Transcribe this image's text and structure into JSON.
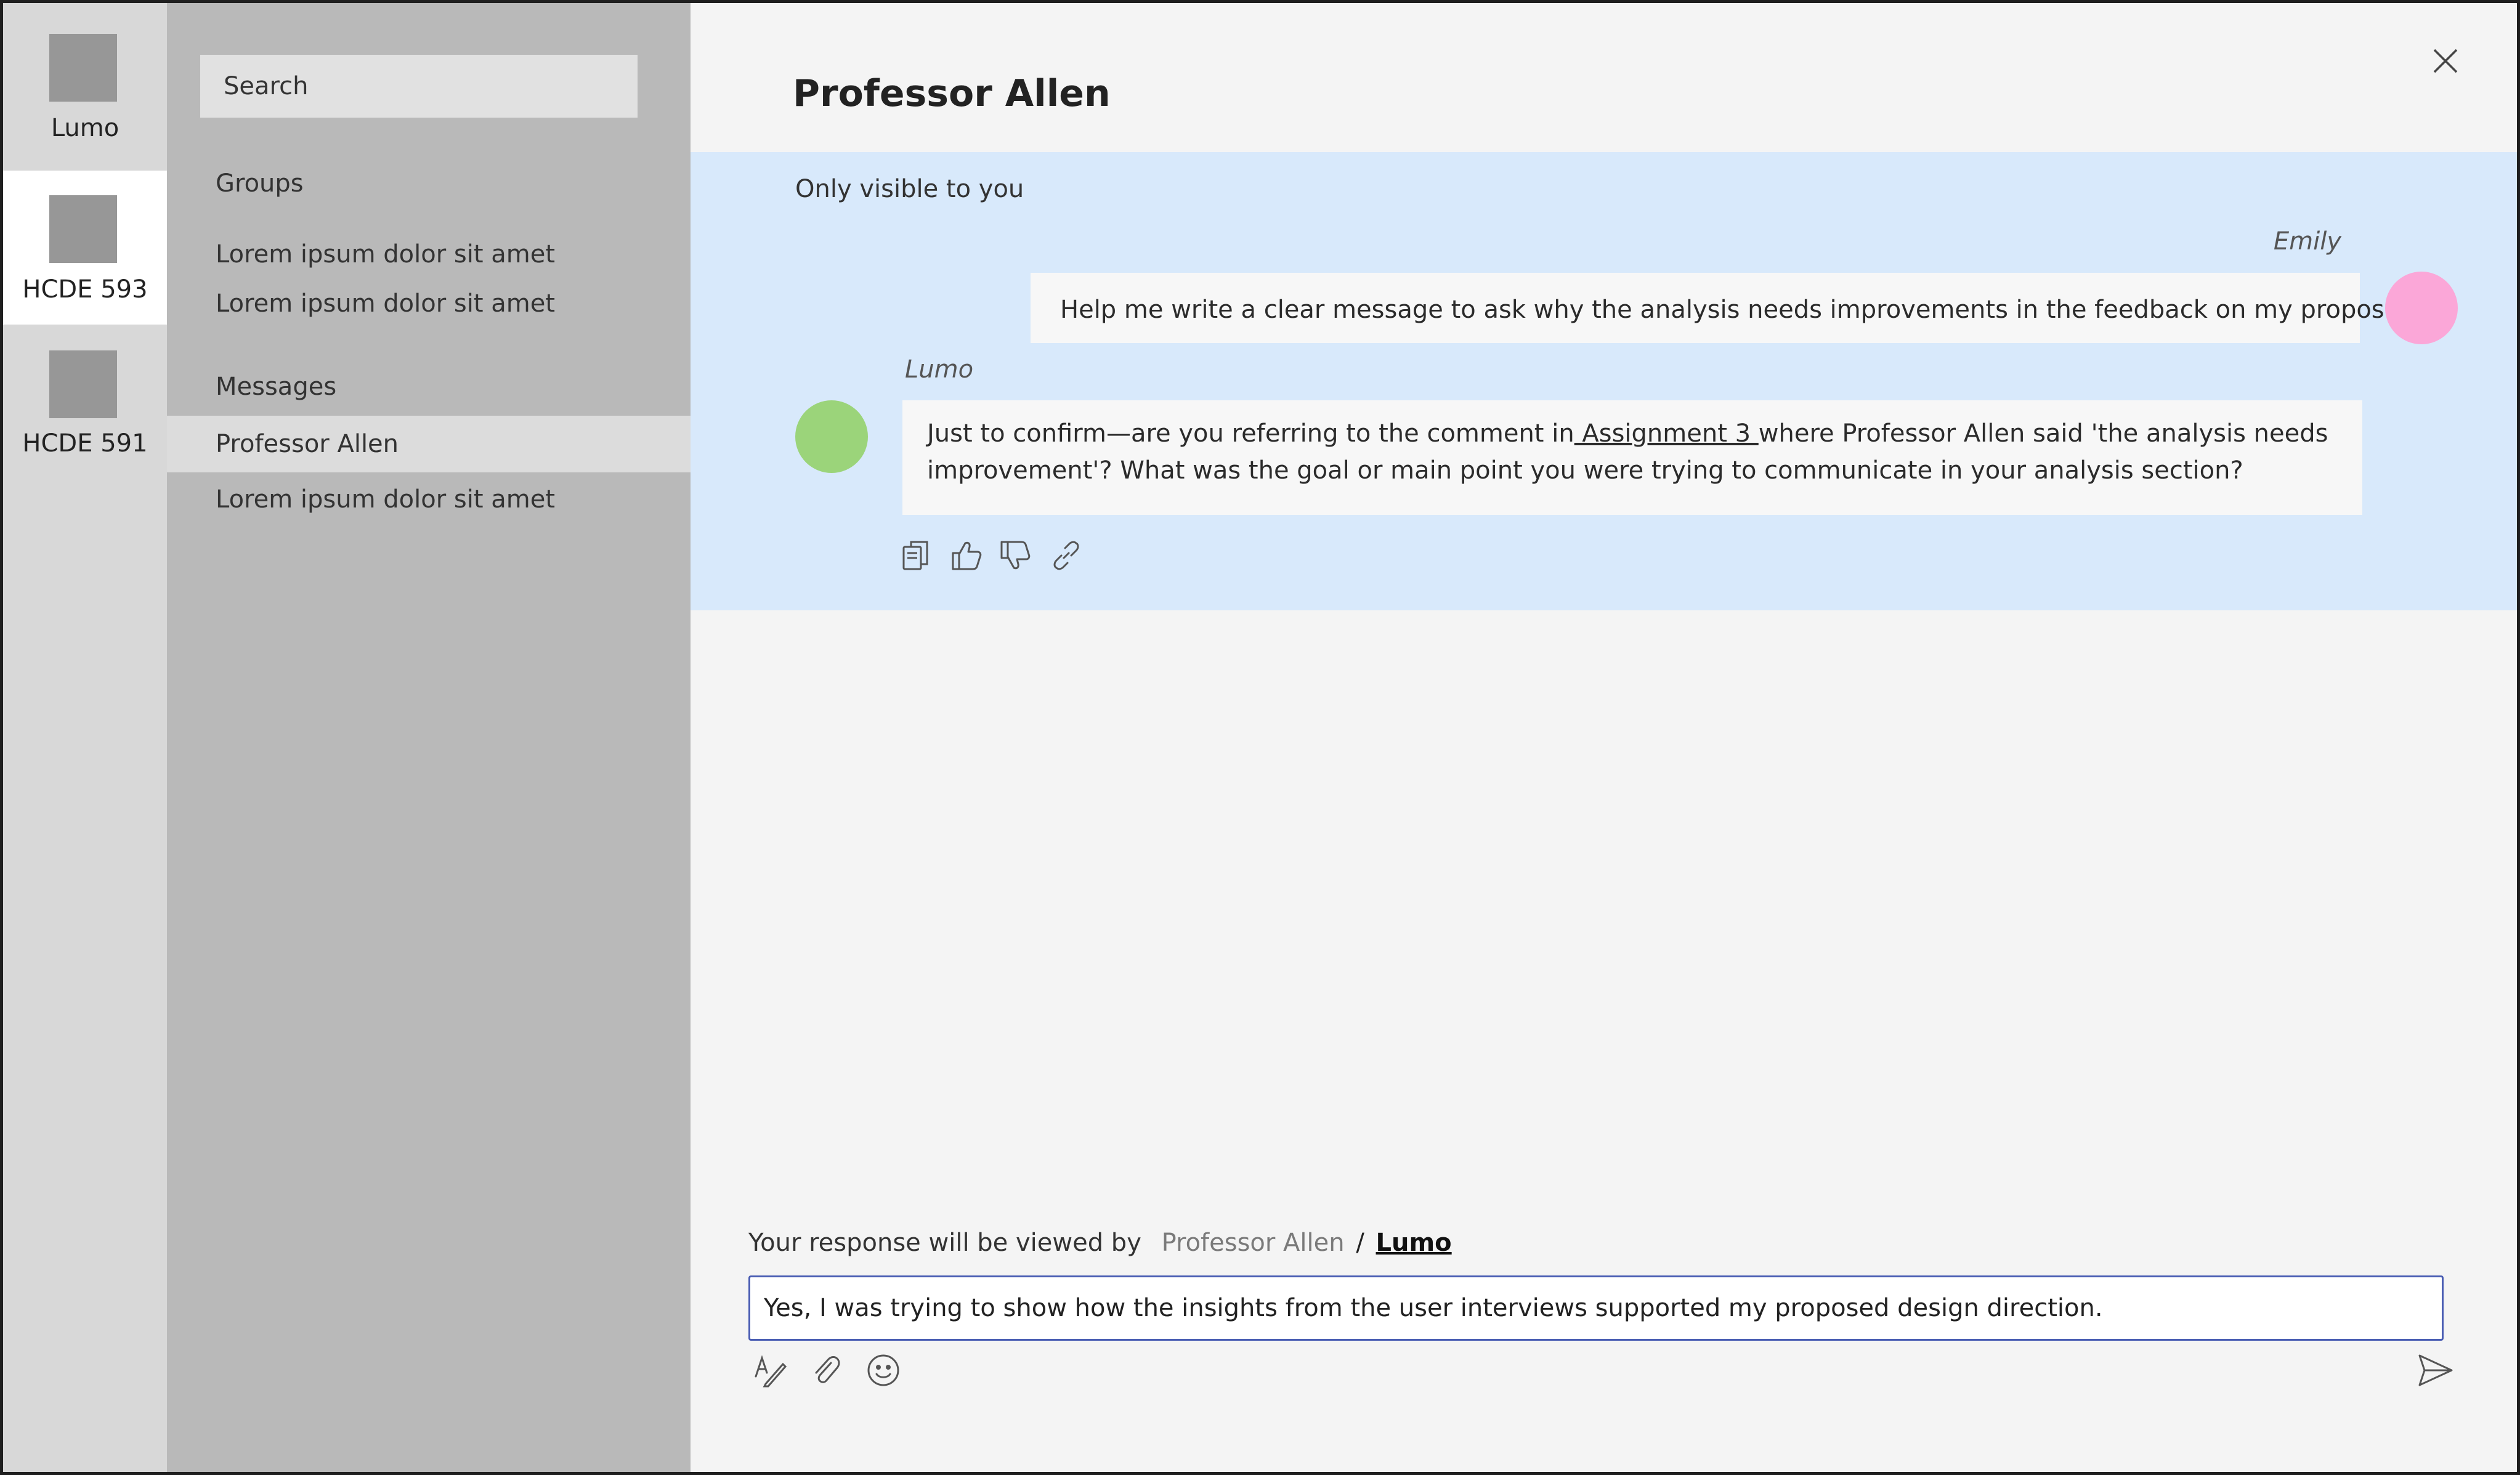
{
  "rail": {
    "items": [
      {
        "label": "Lumo",
        "icon": "app-placeholder-icon"
      },
      {
        "label": "HCDE 593",
        "icon": "app-placeholder-icon",
        "active": true
      },
      {
        "label": "HCDE 591",
        "icon": "app-placeholder-icon"
      }
    ]
  },
  "sidebar": {
    "search_label": "Search",
    "groups_heading": "Groups",
    "groups": [
      "Lorem ipsum dolor sit amet",
      "Lorem ipsum dolor sit amet"
    ],
    "messages_heading": "Messages",
    "messages": [
      {
        "label": "Professor Allen",
        "active": true
      },
      {
        "label": "Lorem ipsum dolor sit amet"
      }
    ]
  },
  "chat": {
    "title": "Professor Allen",
    "close_icon": "close-icon",
    "private_note": "Only visible to you",
    "messages": [
      {
        "sender": "Emily",
        "text": "Help me write a clear message to ask why the analysis needs improvements in the feedback on my proposals",
        "avatar_color": "#fba7d8"
      },
      {
        "sender": "Lumo",
        "text_before": "Just to confirm—are you referring to the comment in",
        "link_text": " Assignment 3 ",
        "text_after": "where Professor Allen said 'the analysis needs improvement'? What was the goal or main point you were trying to communicate in your analysis section?",
        "avatar_color": "#9bd47a"
      }
    ],
    "actions": [
      "copy-icon",
      "thumbs-up-icon",
      "thumbs-down-icon",
      "link-icon"
    ]
  },
  "composer": {
    "viewer_prefix": "Your response will be viewed by",
    "viewer_muted": "Professor Allen",
    "viewer_sep": "/",
    "viewer_active": "Lumo",
    "value": "Yes, I was trying to show how the insights from the user interviews supported my proposed design direction.",
    "tools": [
      "format-icon",
      "attach-icon",
      "emoji-icon"
    ],
    "send_icon": "send-icon"
  },
  "colors": {
    "rail_bg": "#d8d8d8",
    "sidebar_bg": "#b9b9b9",
    "private_bg": "#d8e9fb",
    "input_border": "#4a5db3"
  }
}
